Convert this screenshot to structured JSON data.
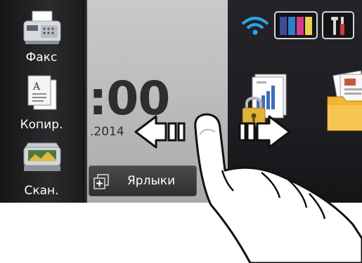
{
  "sidebar": {
    "items": [
      {
        "label": "Факс",
        "icon": "fax-icon"
      },
      {
        "label": "Копир.",
        "icon": "copier-icon"
      },
      {
        "label": "Скан.",
        "icon": "scanner-icon"
      }
    ]
  },
  "clock": {
    "time": ":00",
    "date": ".2014"
  },
  "shortcuts": {
    "label": "Ярлыки",
    "icon": "shortcut-add-icon"
  },
  "status_bar": {
    "wifi_icon": "wifi-icon",
    "ink_icon": "ink-cartridges-icon",
    "ink_colors": [
      "#4a5fb0",
      "#2c7fc6",
      "#d43c8e",
      "#e8d24a"
    ],
    "settings_icon": "tools-icon"
  },
  "main_apps": [
    {
      "icon": "secure-print-report-icon"
    },
    {
      "icon": "documents-folder-icon"
    }
  ],
  "gesture": {
    "swipe_left_icon": "arrow-left-icon",
    "swipe_right_icon": "arrow-right-icon",
    "hand_icon": "pointing-hand-icon"
  },
  "colors": {
    "wifi": "#2aa6e8",
    "accent_lock": "#e0b23a"
  }
}
